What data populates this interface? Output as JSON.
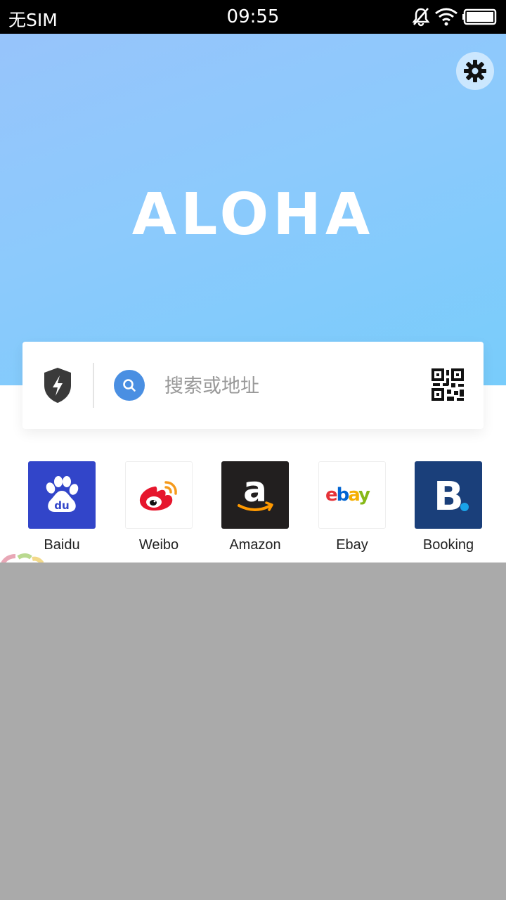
{
  "status_bar": {
    "carrier": "无SIM",
    "time": "09:55",
    "icons": [
      "bell-muted-icon",
      "wifi-icon",
      "battery-icon"
    ]
  },
  "settings": {
    "icon": "gear-icon"
  },
  "brand": {
    "logo": "ALOHA"
  },
  "search": {
    "shield_icon": "shield-lightning-icon",
    "search_icon": "search-icon",
    "placeholder": "搜索或地址",
    "qr_icon": "qr-code-icon"
  },
  "shortcuts": [
    {
      "label": "Baidu",
      "color": "#3245c9"
    },
    {
      "label": "Weibo",
      "color": "#ffffff"
    },
    {
      "label": "Amazon",
      "color": "#221f1f"
    },
    {
      "label": "Ebay",
      "color": "#ffffff"
    },
    {
      "label": "Booking",
      "color": "#1a3f7a"
    }
  ],
  "colors": {
    "hero_start": "#97c4fb",
    "hero_end": "#78ccfb",
    "accent": "#4a8fe2",
    "overlay": "#aaaaaa"
  }
}
